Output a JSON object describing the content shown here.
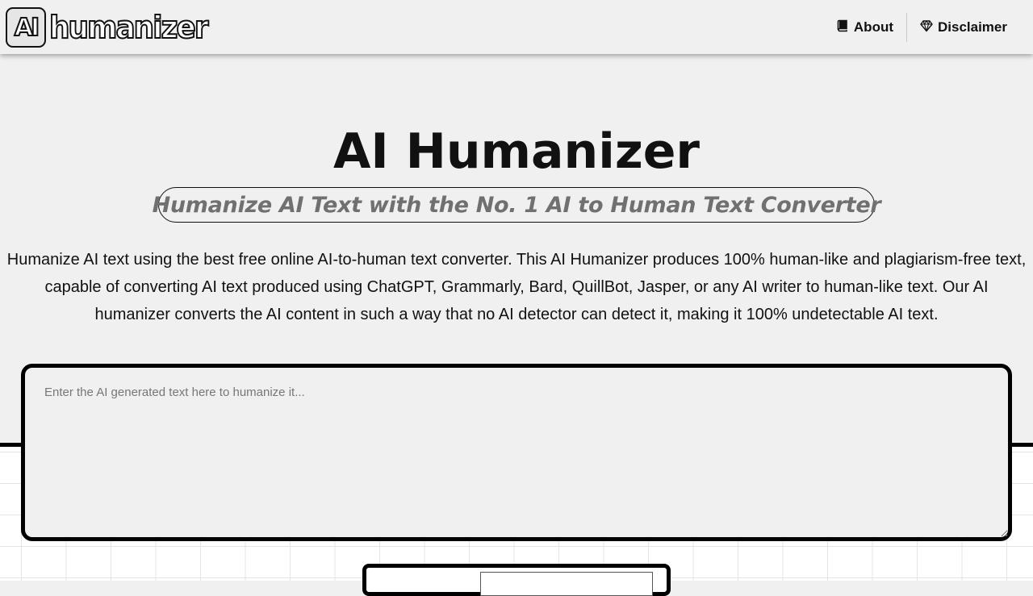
{
  "logo": {
    "badge": "AI",
    "word": "humanizer"
  },
  "nav": {
    "items": [
      {
        "label": "About",
        "icon": "book-icon"
      },
      {
        "label": "Disclaimer",
        "icon": "diamond-icon"
      }
    ]
  },
  "hero": {
    "title": "AI Humanizer",
    "tagline": "Humanize AI Text with the No. 1 AI to Human Text Converter",
    "intro": "Humanize AI text using the best free online AI-to-human text converter. This AI Humanizer produces 100% human-like and plagiarism-free text, capable of converting AI text produced using ChatGPT, Grammarly, Bard, QuillBot, Jasper, or any AI writer to human-like text. Our AI humanizer converts the AI content in such a way that no AI detector can detect it, making it 100% undetectable AI text."
  },
  "editor": {
    "value": "",
    "placeholder": "Enter the AI generated text here to humanize it..."
  },
  "colors": {
    "background": "#f0f0f0",
    "text": "#111111",
    "tagline": "#707070",
    "border": "#000000"
  }
}
